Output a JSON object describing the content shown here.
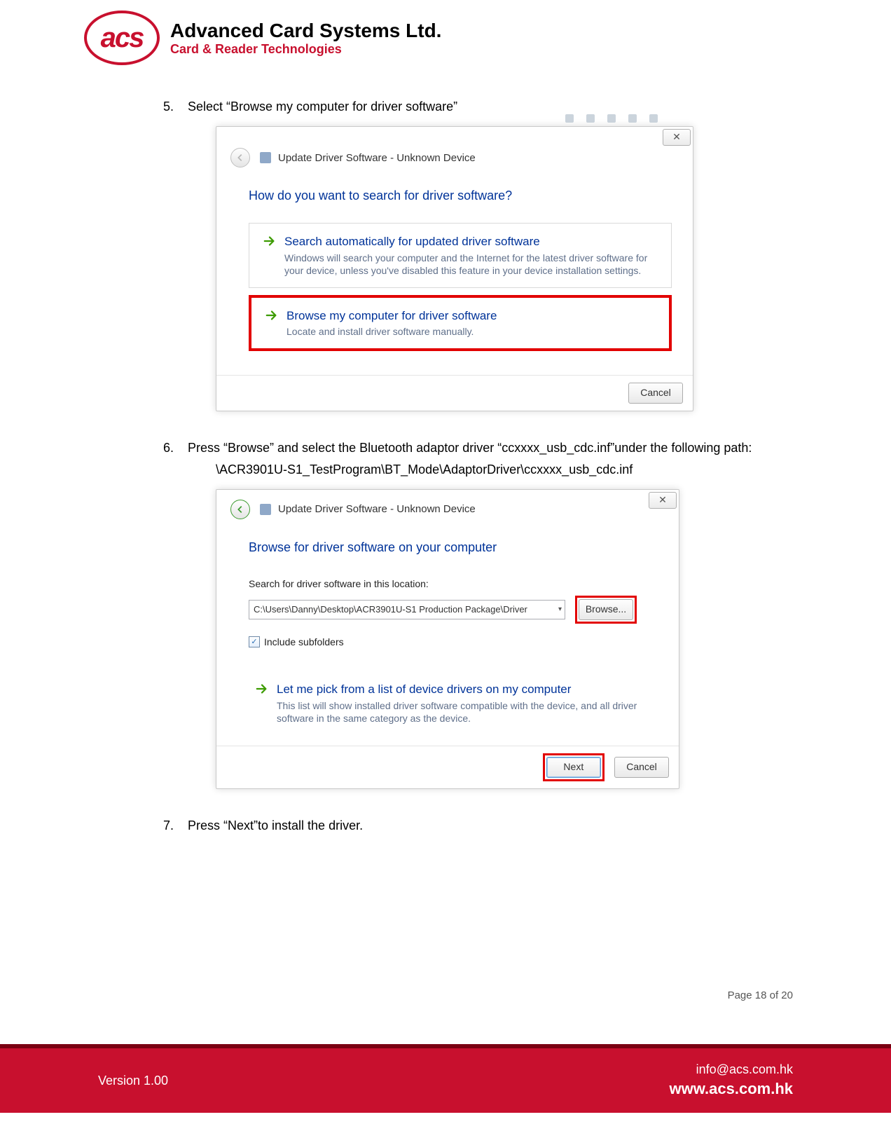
{
  "header": {
    "logo_text": "acs",
    "company_name": "Advanced Card Systems Ltd.",
    "tagline": "Card & Reader Technologies"
  },
  "steps": {
    "s5": {
      "num": "5.",
      "text": "Select “Browse my computer for driver software”"
    },
    "s6": {
      "num": "6.",
      "text": "Press “Browse” and select the Bluetooth adaptor driver “ccxxxx_usb_cdc.inf”under the following path:",
      "path": "\\ACR3901U-S1_TestProgram\\BT_Mode\\AdaptorDriver\\ccxxxx_usb_cdc.inf"
    },
    "s7": {
      "num": "7.",
      "text": "Press “Next”to install the driver."
    }
  },
  "dialog1": {
    "title": "Update Driver Software - Unknown Device",
    "heading": "How do you want to search for driver software?",
    "opt1_title": "Search automatically for updated driver software",
    "opt1_desc": "Windows will search your computer and the Internet for the latest driver software for your device, unless you've disabled this feature in your device installation settings.",
    "opt2_title": "Browse my computer for driver software",
    "opt2_desc": "Locate and install driver software manually.",
    "cancel": "Cancel"
  },
  "dialog2": {
    "title": "Update Driver Software - Unknown Device",
    "heading": "Browse for driver software on your computer",
    "search_label": "Search for driver software in this location:",
    "path_value": "C:\\Users\\Danny\\Desktop\\ACR3901U-S1 Production Package\\Driver",
    "browse_btn": "Browse...",
    "include_sub": "Include subfolders",
    "pick_title": "Let me pick from a list of device drivers on my computer",
    "pick_desc": "This list will show installed driver software compatible with the device, and all driver software in the same category as the device.",
    "next": "Next",
    "cancel": "Cancel"
  },
  "footer": {
    "page_num": "Page 18 of 20",
    "version": "Version 1.00",
    "email": "info@acs.com.hk",
    "url": "www.acs.com.hk"
  }
}
